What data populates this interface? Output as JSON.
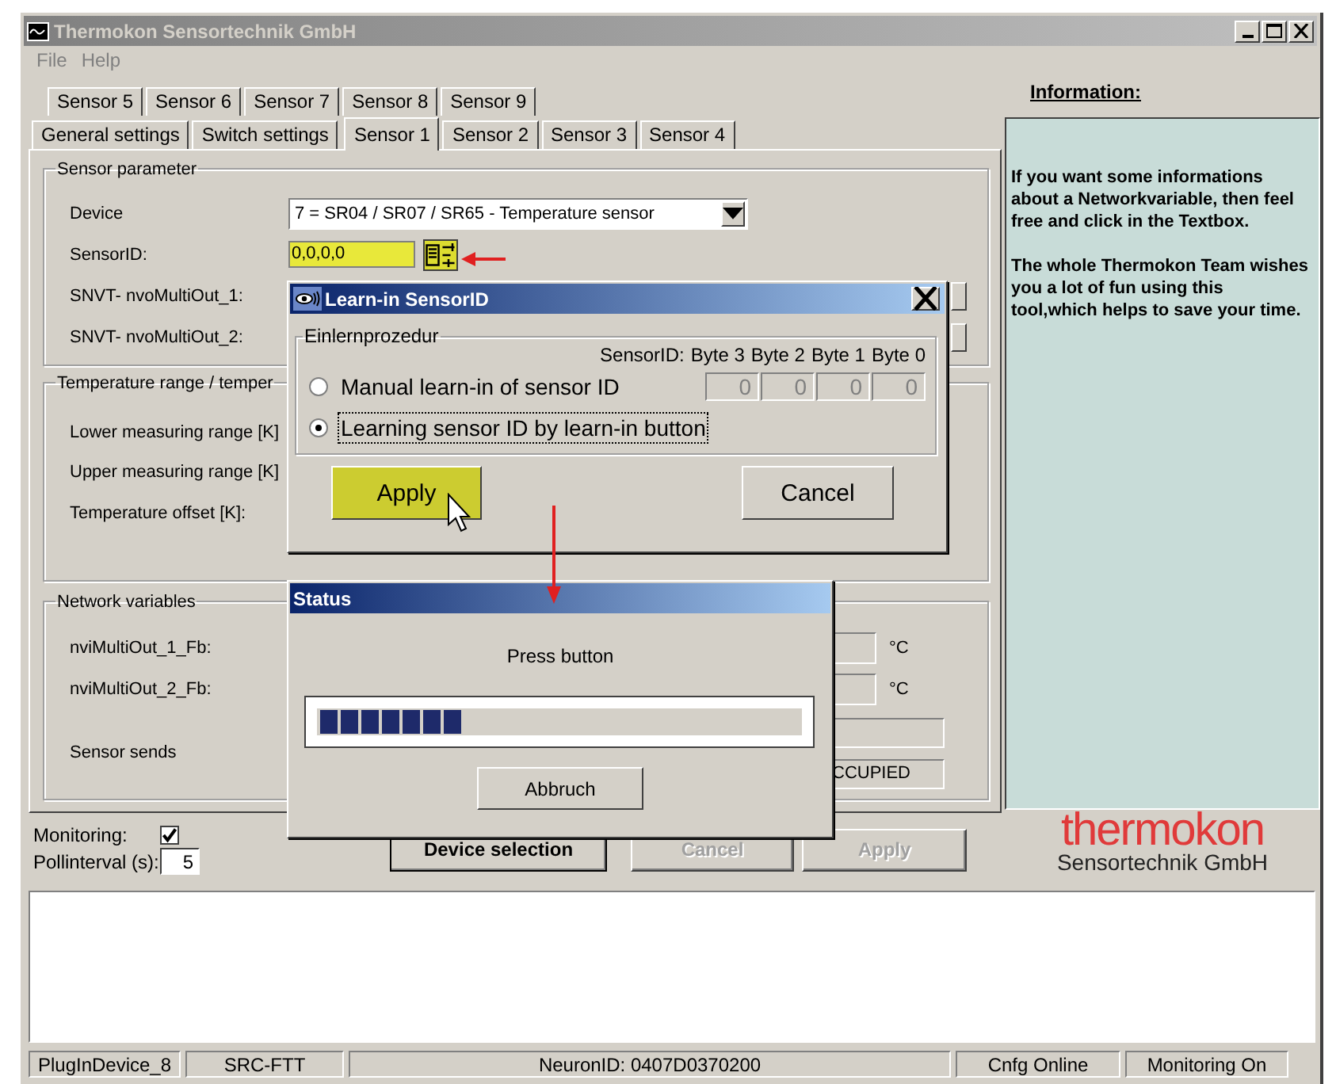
{
  "window": {
    "title": "Thermokon Sensortechnik GmbH"
  },
  "menu": [
    "File",
    "Help"
  ],
  "tabs_row_1": [
    {
      "label": "Sensor 5",
      "selected": false
    },
    {
      "label": "Sensor 6",
      "selected": false
    },
    {
      "label": "Sensor 7",
      "selected": false
    },
    {
      "label": "Sensor 8",
      "selected": false
    },
    {
      "label": "Sensor 9",
      "selected": false
    }
  ],
  "tabs_row_2": [
    {
      "label": "General settings",
      "selected": false
    },
    {
      "label": "Switch settings",
      "selected": false
    },
    {
      "label": "Sensor 1",
      "selected": true
    },
    {
      "label": "Sensor 2",
      "selected": false
    },
    {
      "label": "Sensor 3",
      "selected": false
    },
    {
      "label": "Sensor 4",
      "selected": false
    }
  ],
  "sensor_parameter": {
    "title": "Sensor parameter",
    "device_label": "Device",
    "device_value": "7 = SR04 / SR07 / SR65 - Temperature sensor",
    "sensor_id_label": "SensorID:",
    "sensor_id_value": "0,0,0,0",
    "snvt_labels": [
      "SNVT- nvoMultiOut_1:",
      "SNVT- nvoMultiOut_2:"
    ]
  },
  "temperature_range": {
    "title": "Temperature range / temper",
    "labels": [
      "Lower measuring range [K]",
      "Upper measuring range [K]",
      "Temperature offset [K]:"
    ]
  },
  "network_variables": {
    "title": "Network variables",
    "rows": [
      {
        "label": "nviMultiOut_1_Fb:",
        "unit": "°C"
      },
      {
        "label": "nviMultiOut_2_Fb:",
        "unit": "°C"
      }
    ],
    "sensor_sends_label": "Sensor sends",
    "occupancy_value": "CCUPIED"
  },
  "monitoring": {
    "label": "Monitoring:",
    "checked": true
  },
  "poll_interval": {
    "label": "Pollinterval (s):",
    "value": "5"
  },
  "buttons": [
    {
      "label": "Device selection",
      "disabled": false
    },
    {
      "label": "Cancel",
      "disabled": true
    },
    {
      "label": "Apply",
      "disabled": true
    }
  ],
  "information": {
    "title": "Information:",
    "paragraphs": [
      "If you want some informations about a Networkvariable, then feel free and click in the Textbox.",
      "The whole Thermokon Team wishes you a lot of fun using this tool,which helps to save your time."
    ]
  },
  "logo": {
    "wordmark": "thermokon",
    "subtitle": "Sensortechnik GmbH"
  },
  "status_bar": [
    "PlugInDevice_8",
    "SRC-FTT",
    "NeuronID:  0407D0370200",
    "Cnfg Online",
    "Monitoring On"
  ],
  "learn_dialog": {
    "title": "Learn-in SensorID",
    "group_title": "Einlernprozedur",
    "sensor_id_label": "SensorID:",
    "byte_headers": [
      "Byte 3",
      "Byte 2",
      "Byte 1",
      "Byte 0"
    ],
    "byte_values": [
      "0",
      "0",
      "0",
      "0"
    ],
    "options": [
      {
        "label": "Manual learn-in of sensor ID",
        "selected": false
      },
      {
        "label": "Learning sensor ID by learn-in button",
        "selected": true
      }
    ],
    "buttons": [
      {
        "label": "Apply",
        "highlighted": true
      },
      {
        "label": "Cancel",
        "highlighted": false
      }
    ]
  },
  "status_dialog": {
    "title": "Status",
    "message": "Press button",
    "progress": {
      "level": 0.29
    },
    "button": "Abbruch"
  }
}
